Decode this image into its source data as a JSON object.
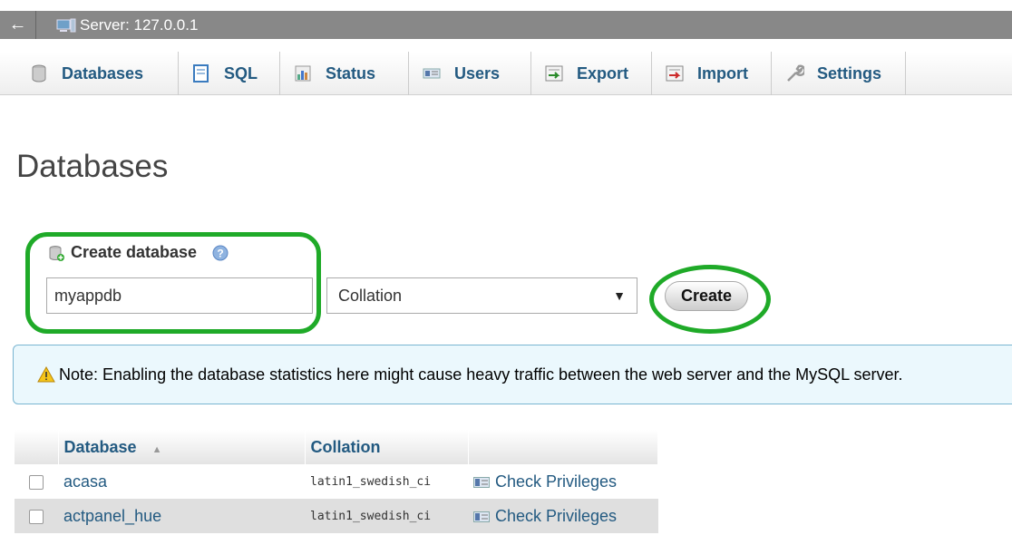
{
  "topbar": {
    "back_glyph": "←",
    "server_label": "Server: 127.0.0.1",
    "server_icon": "server-icon"
  },
  "tabs": [
    {
      "label": "Databases",
      "icon": "database-icon"
    },
    {
      "label": "SQL",
      "icon": "sql-icon"
    },
    {
      "label": "Status",
      "icon": "status-chart-icon"
    },
    {
      "label": "Users",
      "icon": "users-icon"
    },
    {
      "label": "Export",
      "icon": "export-icon"
    },
    {
      "label": "Import",
      "icon": "import-icon"
    },
    {
      "label": "Settings",
      "icon": "wrench-icon"
    }
  ],
  "page": {
    "title": "Databases"
  },
  "create_db": {
    "label": "Create database",
    "name_value": "myappdb",
    "collation_selected": "Collation",
    "create_label": "Create",
    "highlight_color": "#1faa28"
  },
  "notice": {
    "text": "Note: Enabling the database statistics here might cause heavy traffic between the web server and the MySQL server."
  },
  "table": {
    "headers": {
      "database": "Database",
      "collation": "Collation"
    },
    "rows": [
      {
        "name": "acasa",
        "collation": "latin1_swedish_ci",
        "action": "Check Privileges"
      },
      {
        "name": "actpanel_hue",
        "collation": "latin1_swedish_ci",
        "action": "Check Privileges"
      }
    ]
  },
  "colors": {
    "link": "#235a81",
    "topbar": "#888888",
    "notice_bg": "#ebf8fd"
  }
}
